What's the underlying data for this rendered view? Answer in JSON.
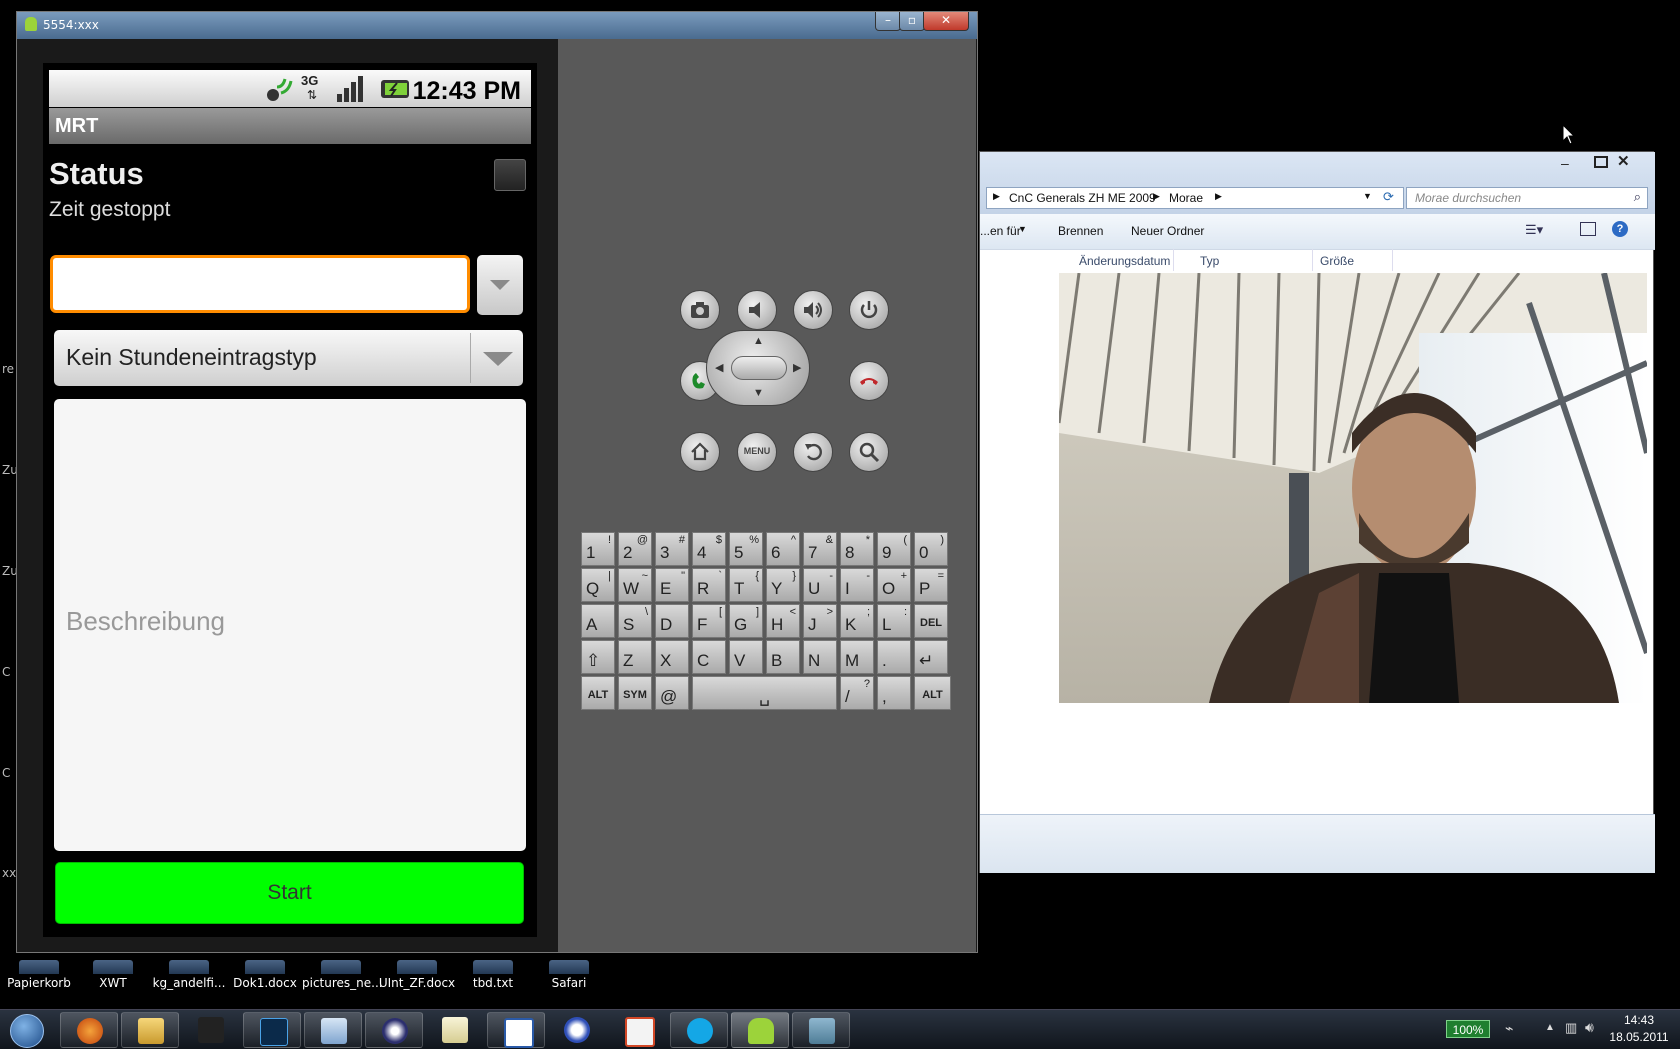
{
  "desktop": {
    "icons": [
      {
        "label": "Papierkorb"
      },
      {
        "label": "XWT"
      },
      {
        "label": "kg_andelfi..."
      },
      {
        "label": "Dok1.docx"
      },
      {
        "label": "pictures_ne..."
      },
      {
        "label": "UInt_ZF.docx"
      },
      {
        "label": "tbd.txt"
      },
      {
        "label": "Safari"
      }
    ]
  },
  "emulator": {
    "window_title": "5554:xxx",
    "status_bar": {
      "time": "12:43 PM",
      "network": "3G"
    },
    "app_title": "MRT",
    "heading": "Status",
    "subheading": "Zeit gestoppt",
    "text_field_value": "",
    "spinner_value": "Kein Stundeneintragstyp",
    "description_placeholder": "Beschreibung",
    "start_button": "Start",
    "controls": {
      "menu_label": "MENU"
    },
    "keyboard": {
      "rows": [
        [
          [
            "1",
            "!"
          ],
          [
            "2",
            "@"
          ],
          [
            "3",
            "#"
          ],
          [
            "4",
            "$"
          ],
          [
            "5",
            "%"
          ],
          [
            "6",
            "^"
          ],
          [
            "7",
            "&"
          ],
          [
            "8",
            "*"
          ],
          [
            "9",
            "("
          ],
          [
            "0",
            ")"
          ]
        ],
        [
          [
            "Q",
            "|"
          ],
          [
            "W",
            "~"
          ],
          [
            "E",
            "\""
          ],
          [
            "R",
            "`"
          ],
          [
            "T",
            "{"
          ],
          [
            "Y",
            "}"
          ],
          [
            "U",
            "-"
          ],
          [
            "I",
            "-"
          ],
          [
            "O",
            "+"
          ],
          [
            "P",
            "="
          ]
        ],
        [
          [
            "A",
            ""
          ],
          [
            "S",
            "\\"
          ],
          [
            "D",
            ""
          ],
          [
            "F",
            "["
          ],
          [
            "G",
            "]"
          ],
          [
            "H",
            "<"
          ],
          [
            "J",
            ">"
          ],
          [
            "K",
            ";"
          ],
          [
            "L",
            ":"
          ],
          [
            "DEL",
            ""
          ]
        ],
        [
          [
            "⇧",
            ""
          ],
          [
            "Z",
            ""
          ],
          [
            "X",
            ""
          ],
          [
            "C",
            ""
          ],
          [
            "V",
            ""
          ],
          [
            "B",
            ""
          ],
          [
            "N",
            ""
          ],
          [
            "M",
            ""
          ],
          [
            ".",
            ""
          ],
          [
            "↵",
            ""
          ]
        ]
      ],
      "bottom_row": {
        "alt": "ALT",
        "sym": "SYM",
        "at": "@",
        "space": "␣",
        "slash": "/",
        "question": "?",
        "comma": ","
      }
    }
  },
  "explorer": {
    "breadcrumb": [
      "CnC Generals ZH ME 2009",
      "Morae"
    ],
    "search_placeholder": "Morae durchsuchen",
    "toolbar": {
      "share": "...en für",
      "burn": "Brennen",
      "new_folder": "Neuer Ordner"
    },
    "columns": [
      "Änderungsdatum",
      "Typ",
      "Größe"
    ]
  },
  "taskbar": {
    "battery": "100%",
    "time": "14:43",
    "date": "18.05.2011"
  }
}
